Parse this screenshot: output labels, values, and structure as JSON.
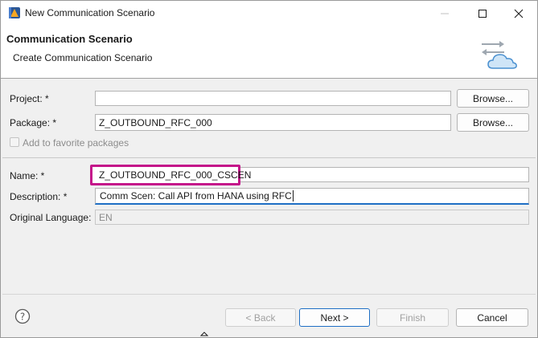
{
  "window": {
    "title": "New Communication Scenario",
    "icon": "eclipse-adt-icon"
  },
  "banner": {
    "title": "Communication Scenario",
    "subtitle": "Create Communication Scenario",
    "icon": "cloud-transfer-icon"
  },
  "form": {
    "project": {
      "label": "Project: *",
      "value": ""
    },
    "package": {
      "label": "Package: *",
      "value": "Z_OUTBOUND_RFC_000"
    },
    "browse_label": "Browse...",
    "favorite": {
      "label": "Add to favorite packages",
      "checked": false
    },
    "name": {
      "label": "Name: *",
      "value": "Z_OUTBOUND_RFC_000_CSCEN"
    },
    "description": {
      "label": "Description: *",
      "value": "Comm Scen: Call API from HANA using RFC"
    },
    "original_language": {
      "label": "Original Language:",
      "value": "EN"
    }
  },
  "buttons": {
    "back": "< Back",
    "next": "Next >",
    "finish": "Finish",
    "cancel": "Cancel"
  },
  "colors": {
    "highlight": "#c4158a",
    "focus": "#1f6fc5"
  }
}
